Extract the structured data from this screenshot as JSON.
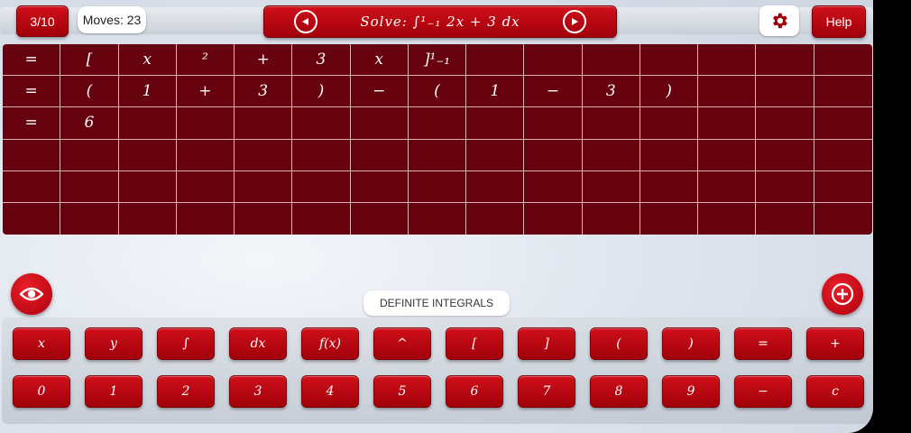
{
  "header": {
    "level": "3/10",
    "moves": "Moves: 23",
    "problem": "Solve:  ∫¹₋₁  2x  +  3  dx",
    "help": "Help"
  },
  "grid": {
    "rows": [
      [
        "=",
        "[",
        "x",
        "²",
        "+",
        "3",
        "x",
        "]¹₋₁",
        "",
        "",
        "",
        "",
        "",
        "",
        ""
      ],
      [
        "=",
        "(",
        "1",
        "+",
        "3",
        ")",
        "−",
        "(",
        "1",
        "−",
        "3",
        ")",
        "",
        "",
        ""
      ],
      [
        "=",
        "6",
        "",
        "",
        "",
        "",
        "",
        "",
        "",
        "",
        "",
        "",
        "",
        "",
        ""
      ],
      [
        "",
        "",
        "",
        "",
        "",
        "",
        "",
        "",
        "",
        "",
        "",
        "",
        "",
        "",
        ""
      ],
      [
        "",
        "",
        "",
        "",
        "",
        "",
        "",
        "",
        "",
        "",
        "",
        "",
        "",
        "",
        ""
      ],
      [
        "",
        "",
        "",
        "",
        "",
        "",
        "",
        "",
        "",
        "",
        "",
        "",
        "",
        "",
        ""
      ]
    ]
  },
  "category": "DEFINITE INTEGRALS",
  "keyboard": {
    "row1": [
      "x",
      "y",
      "∫",
      "dx",
      "f(x)",
      "^",
      "[",
      "]",
      "(",
      ")",
      "=",
      "+"
    ],
    "row2": [
      "0",
      "1",
      "2",
      "3",
      "4",
      "5",
      "6",
      "7",
      "8",
      "9",
      "−",
      "c"
    ]
  },
  "icons": {
    "prev": "prev-icon",
    "next": "next-icon",
    "settings": "gear-icon",
    "eye": "eye-icon",
    "add": "plus-circle-icon"
  },
  "colors": {
    "accent": "#c4000f",
    "grid": "#66030e"
  }
}
